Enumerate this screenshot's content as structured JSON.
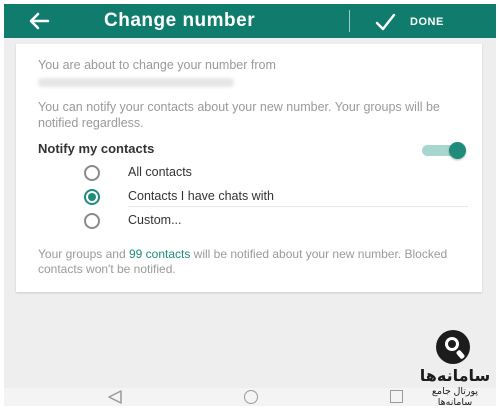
{
  "appbar": {
    "title": "Change number",
    "back_icon": "arrow-left-icon",
    "done_icon": "checkmark-icon",
    "done_label": "DONE",
    "color": "#0f7c6e"
  },
  "card": {
    "intro": "You are about to change your number from",
    "notify_text": "You can notify your contacts about your new number. Your groups will be notified regardless.",
    "notify_label": "Notify my contacts",
    "notify_enabled": true,
    "options": [
      {
        "label": "All contacts",
        "selected": false
      },
      {
        "label": "Contacts I have chats with",
        "selected": true
      },
      {
        "label": "Custom...",
        "selected": false
      }
    ],
    "footer": {
      "before": "Your groups and ",
      "link": "99 contacts",
      "after": " will be notified about your new number. Blocked contacts won't be notified."
    }
  },
  "navbar": {
    "back_icon": "nav-back-triangle-icon",
    "home_icon": "nav-home-circle-icon",
    "recent_icon": "nav-recent-square-icon"
  },
  "watermark": {
    "name": "سامانه‌ها",
    "subtitle": "پورتال جامع سامانه‌ها",
    "icon": "magnifier-logo-icon"
  },
  "colors": {
    "accent": "#1e8b7b",
    "muted_text": "#9a9a9a"
  }
}
